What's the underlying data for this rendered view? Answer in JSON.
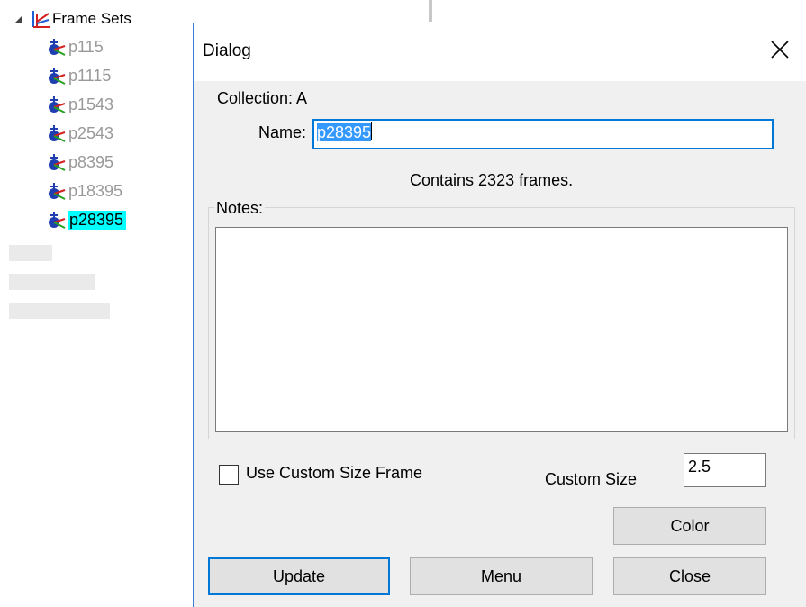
{
  "tree": {
    "root_label": "Frame Sets",
    "items": [
      {
        "label": "p115",
        "selected": false
      },
      {
        "label": "p1115",
        "selected": false
      },
      {
        "label": "p1543",
        "selected": false
      },
      {
        "label": "p2543",
        "selected": false
      },
      {
        "label": "p8395",
        "selected": false
      },
      {
        "label": "p18395",
        "selected": false
      },
      {
        "label": "p28395",
        "selected": true
      }
    ],
    "selection_color": "#00ffff"
  },
  "dialog": {
    "title": "Dialog",
    "collection_label": "Collection: A",
    "name_label": "Name:",
    "name_value": "p28395",
    "frames_text": "Contains 2323 frames.",
    "notes_label": "Notes:",
    "notes_value": "",
    "custom_frame_label": "Use Custom Size Frame",
    "custom_frame_checked": false,
    "custom_size_label": "Custom Size",
    "custom_size_value": "2.5",
    "buttons": {
      "color": "Color",
      "update": "Update",
      "menu": "Menu",
      "close": "Close"
    },
    "accent_color": "#0078d7"
  }
}
